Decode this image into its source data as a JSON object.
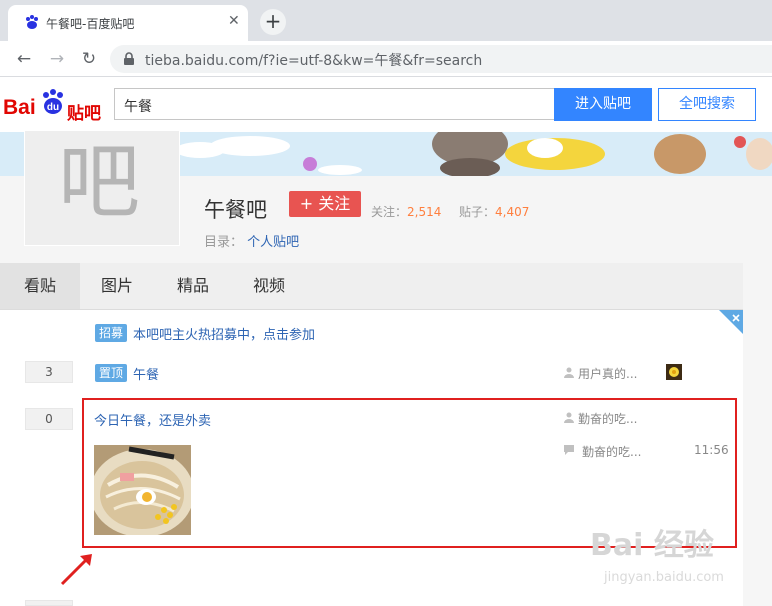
{
  "browser": {
    "tab_title": "午餐吧-百度贴吧",
    "new_tab_label": "+",
    "close_label": "✕",
    "url": "tieba.baidu.com/f?ie=utf-8&kw=午餐&fr=search"
  },
  "header": {
    "logo_bai": "Bai",
    "logo_du": "du",
    "logo_tieba": "贴吧",
    "search_value": "午餐",
    "enter_button": "进入贴吧",
    "all_search_button": "全吧搜索"
  },
  "forum": {
    "avatar_char": "吧",
    "name": "午餐吧",
    "follow_button": "+ 关注",
    "followers_label": "关注：",
    "followers_count": "2,514",
    "posts_label": "贴子：",
    "posts_count": "4,407",
    "directory_label": "目录：",
    "directory_value": "个人贴吧"
  },
  "tabs": [
    "看贴",
    "图片",
    "精品",
    "视频"
  ],
  "threads": {
    "recruit": {
      "badge": "招募",
      "title": "本吧吧主火热招募中，点击参加"
    },
    "pinned": {
      "reply_count": "3",
      "badge": "置顶",
      "title": "午餐",
      "author": "用户真的..."
    },
    "post": {
      "reply_count": "0",
      "title": "今日午餐，还是外卖",
      "author": "勤奋的吃...",
      "last_reply_author": "勤奋的吃...",
      "last_reply_time": "11:56"
    }
  },
  "watermark": {
    "main": "Bai 经验",
    "sub": "jingyan.baidu.com"
  },
  "colors": {
    "brand_red": "#e10602",
    "link_blue": "#2d64b3",
    "button_blue": "#3385ff",
    "highlight_red": "#e0201f"
  }
}
